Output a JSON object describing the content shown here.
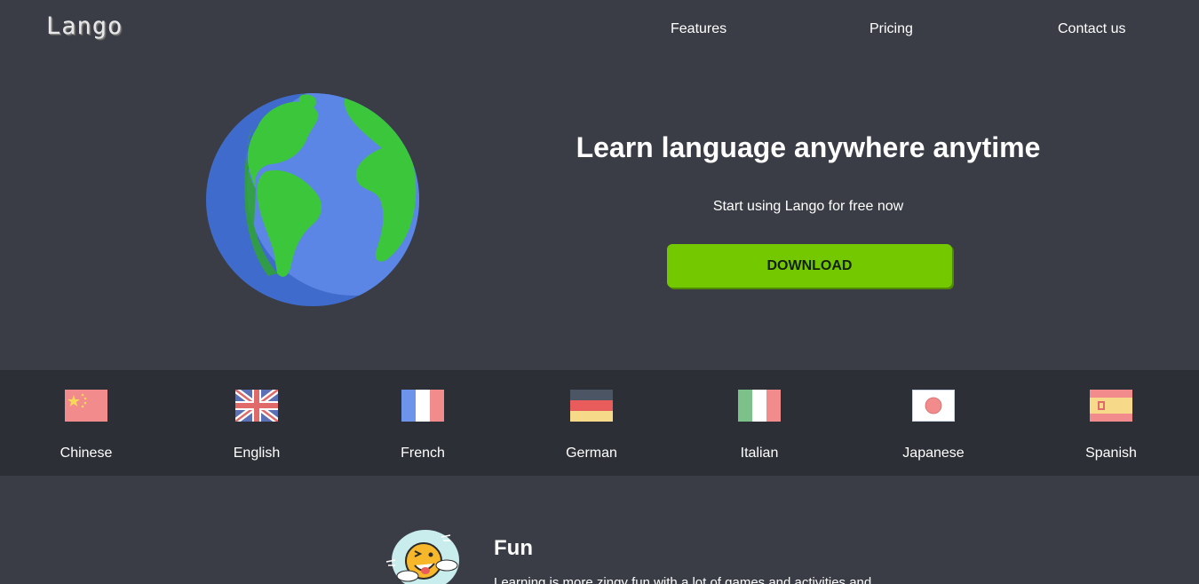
{
  "brand": {
    "logo": "Lango"
  },
  "nav": {
    "features": "Features",
    "pricing": "Pricing",
    "contact": "Contact us"
  },
  "hero": {
    "title": "Learn language anywhere anytime",
    "subtitle": "Start using Lango for free now",
    "download_label": "DOWNLOAD",
    "illustration_icon": "globe-icon"
  },
  "languages": [
    {
      "label": "Chinese",
      "icon": "china-flag-icon"
    },
    {
      "label": "English",
      "icon": "uk-flag-icon"
    },
    {
      "label": "French",
      "icon": "france-flag-icon"
    },
    {
      "label": "German",
      "icon": "germany-flag-icon"
    },
    {
      "label": "Italian",
      "icon": "italy-flag-icon"
    },
    {
      "label": "Japanese",
      "icon": "japan-flag-icon"
    },
    {
      "label": "Spanish",
      "icon": "spain-flag-icon"
    }
  ],
  "features": {
    "fun_title": "Fun",
    "fun_text": "Learning is more zingy fun with a lot of games and activities and",
    "fun_icon": "winking-emoji-icon"
  },
  "colors": {
    "background": "#3a3d46",
    "band": "#2d2f36",
    "accent": "#74c800",
    "globe_ocean": "#5b86e5",
    "globe_land": "#3cc63c"
  }
}
